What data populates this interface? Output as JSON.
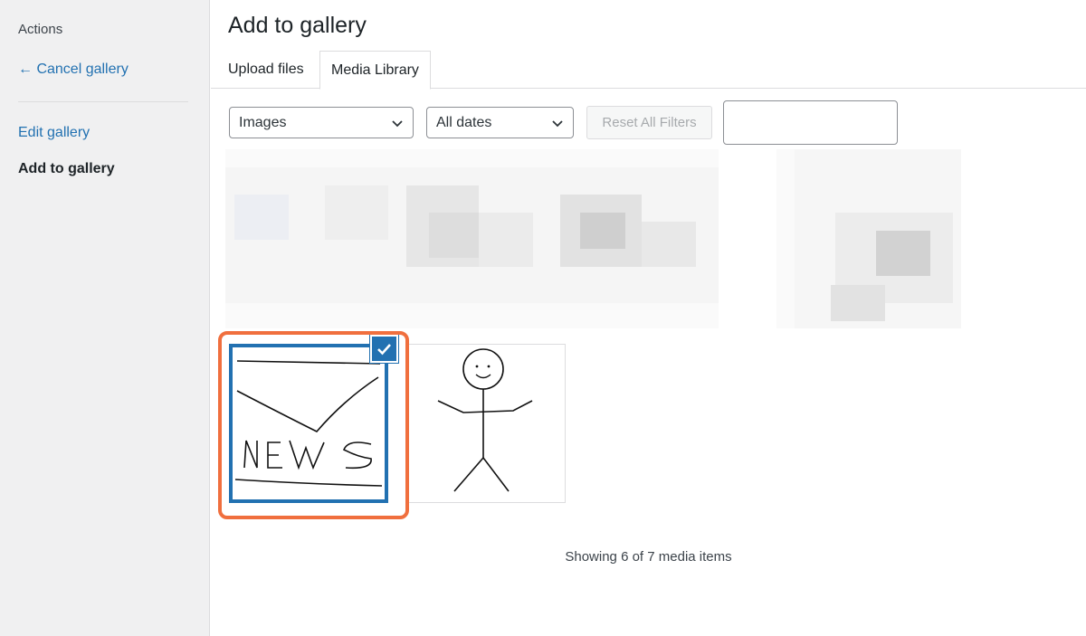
{
  "sidebar": {
    "heading": "Actions",
    "cancel_link": "← Cancel gallery",
    "edit_link": "Edit gallery",
    "current": "Add to gallery"
  },
  "frame": {
    "title": "Add to gallery",
    "tabs": [
      {
        "label": "Upload files",
        "active": false
      },
      {
        "label": "Media Library",
        "active": true
      }
    ]
  },
  "filters": {
    "type_selected": "Images",
    "date_selected": "All dates",
    "reset_label": "Reset All Filters",
    "search_value": ""
  },
  "media": {
    "items": [
      {
        "icon": "news-drawing-icon",
        "selected": true
      },
      {
        "icon": "stick-figure-drawing-icon",
        "selected": false
      }
    ],
    "count_text": "Showing 6 of 7 media items"
  },
  "colors": {
    "accent": "#2271b1",
    "highlight": "#f06f3e"
  }
}
